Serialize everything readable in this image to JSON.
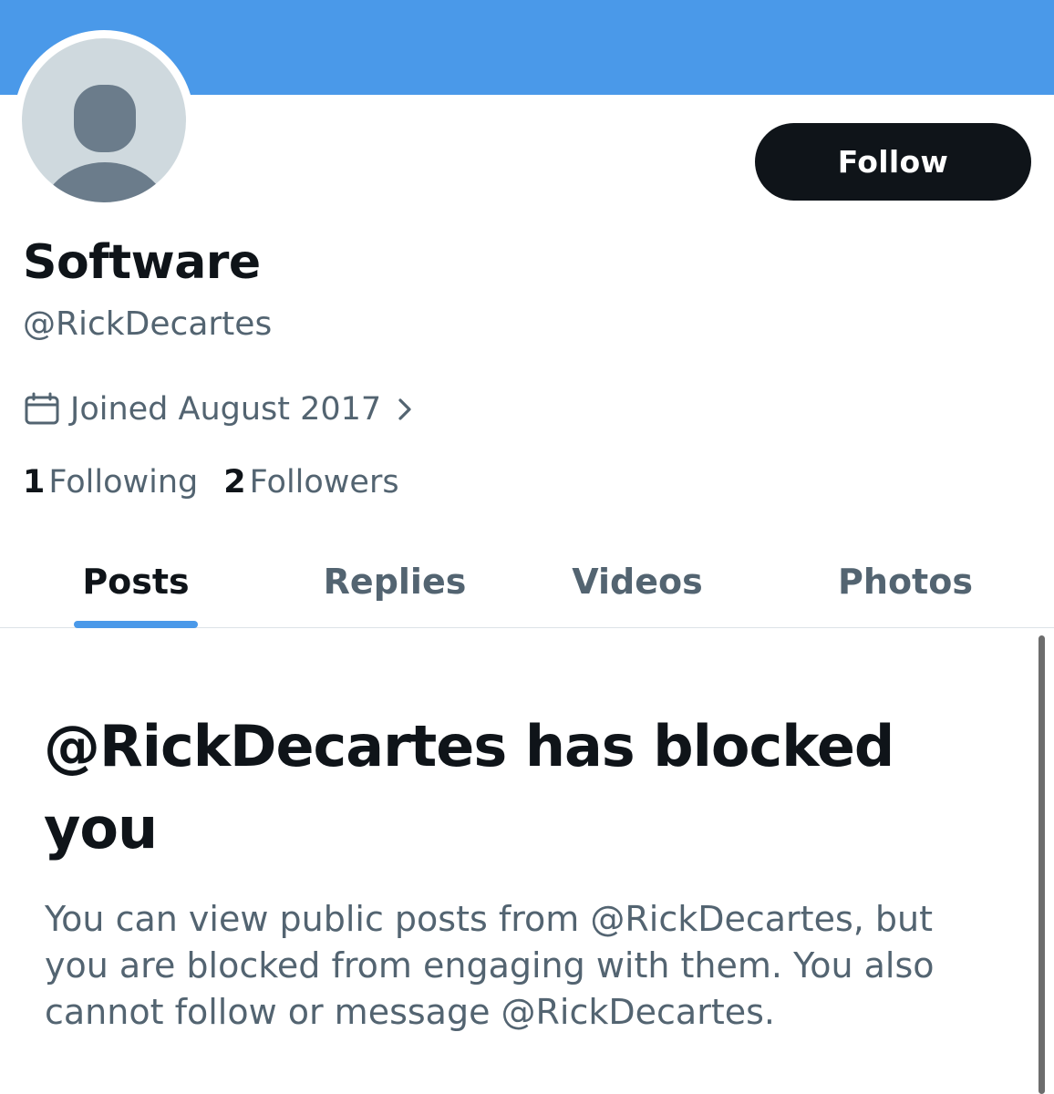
{
  "profile": {
    "display_name": "Software",
    "handle": "@RickDecartes",
    "joined": "Joined August 2017",
    "following_count": "1",
    "following_label": "Following",
    "followers_count": "2",
    "followers_label": "Followers"
  },
  "actions": {
    "follow_label": "Follow"
  },
  "tabs": [
    {
      "label": "Posts",
      "active": true
    },
    {
      "label": "Replies",
      "active": false
    },
    {
      "label": "Videos",
      "active": false
    },
    {
      "label": "Photos",
      "active": false
    }
  ],
  "blocked": {
    "title": "@RickDecartes has blocked you",
    "description": "You can view public posts from @RickDecartes, but you are blocked from engaging with them. You also cannot follow or message @RickDecartes."
  },
  "icons": {
    "calendar": "calendar-icon",
    "chevron": "chevron-right-icon",
    "avatar": "default-avatar-icon"
  },
  "colors": {
    "accent": "#4a99e9",
    "text_primary": "#0f1419",
    "text_secondary": "#536471",
    "avatar_bg": "#cfd9de",
    "avatar_figure": "#6b7c8b"
  }
}
